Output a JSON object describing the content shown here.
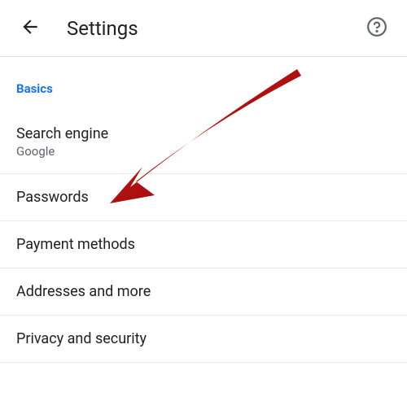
{
  "header": {
    "title": "Settings"
  },
  "section": {
    "label": "Basics"
  },
  "rows": {
    "searchEngine": {
      "title": "Search engine",
      "subtitle": "Google"
    },
    "passwords": {
      "title": "Passwords"
    },
    "paymentMethods": {
      "title": "Payment methods"
    },
    "addresses": {
      "title": "Addresses and more"
    },
    "privacy": {
      "title": "Privacy and security"
    }
  }
}
